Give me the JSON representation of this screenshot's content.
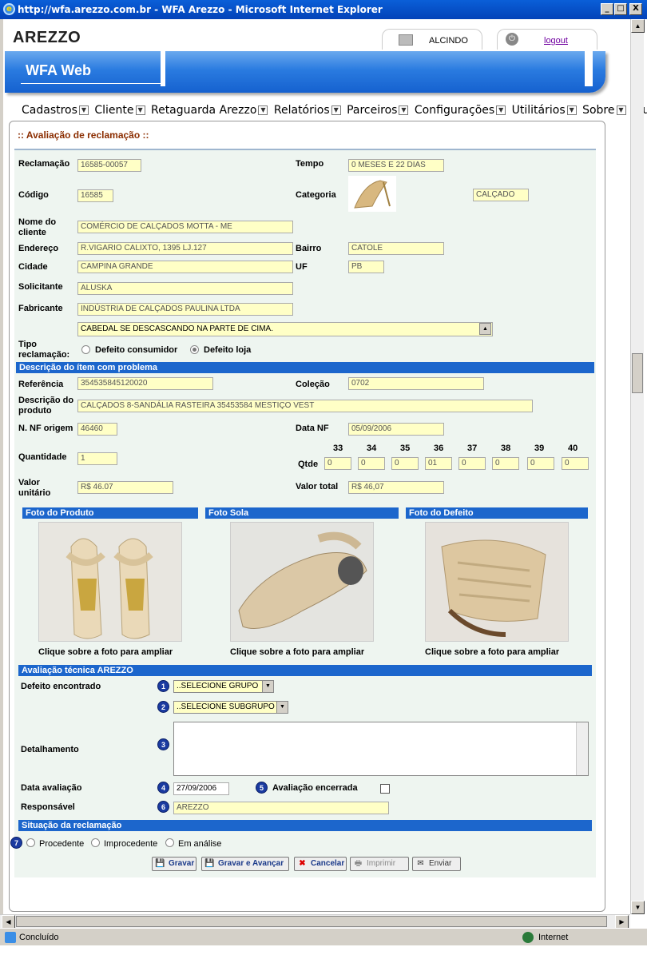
{
  "window": {
    "title": "http://wfa.arezzo.com.br - WFA Arezzo - Microsoft Internet Explorer",
    "min": "_",
    "max": "□",
    "close": "X"
  },
  "header": {
    "brand": "AREZZO",
    "user": "ALCINDO",
    "logout": "logout",
    "banner": "WFA Web"
  },
  "menu": [
    "Cadastros",
    "Cliente",
    "Retaguarda Arezzo",
    "Relatórios",
    "Parceiros",
    "Configurações",
    "Utilitários",
    "Sobre",
    "Ajuda"
  ],
  "panel": {
    "title": ":: Avaliação de reclamação ::"
  },
  "form": {
    "reclamacao_label": "Reclamação",
    "reclamacao": "16585-00057",
    "tempo_label": "Tempo",
    "tempo": "0 MESES E 22 DIAS",
    "codigo_label": "Código",
    "codigo": "16585",
    "categoria_label": "Categoria",
    "categoria": "CALÇADO",
    "nome_label": "Nome do cliente",
    "nome": "COMÉRCIO DE CALÇADOS MOTTA - ME",
    "endereco_label": "Endereço",
    "endereco": "R.VIGARIO CALIXTO, 1395 LJ.127",
    "bairro_label": "Bairro",
    "bairro": "CATOLE",
    "cidade_label": "Cidade",
    "cidade": "CAMPINA GRANDE",
    "uf_label": "UF",
    "uf": "PB",
    "solicitante_label": "Solicitante",
    "solicitante": "ALUSKA",
    "fabricante_label": "Fabricante",
    "fabricante": "INDÚSTRIA DE CALÇADOS PAULINA LTDA",
    "observacao": "CABEDAL SE DESCASCANDO NA PARTE DE CIMA.",
    "tipo_label": "Tipo reclamação:",
    "tipo_opt1": "Defeito consumidor",
    "tipo_opt2": "Defeito loja"
  },
  "item": {
    "section": "Descrição do ítem com problema",
    "referencia_label": "Referência",
    "referencia": "354535845120020",
    "colecao_label": "Coleção",
    "colecao": "0702",
    "descricao_label": "Descrição do produto",
    "descricao": "CALÇADOS 8-SANDÁLIA RASTEIRA 35453584 MESTIÇO VEST",
    "nf_label": "N. NF origem",
    "nf": "46460",
    "datanf_label": "Data NF",
    "datanf": "05/09/2006",
    "quantidade_label": "Quantidade",
    "quantidade": "1",
    "qtde_label": "Qtde",
    "sizes": [
      "33",
      "34",
      "35",
      "36",
      "37",
      "38",
      "39",
      "40"
    ],
    "qtys": [
      "0",
      "0",
      "0",
      "01",
      "0",
      "0",
      "0",
      "0"
    ],
    "valor_label": "Valor unitário",
    "valor": "R$ 46.07",
    "total_label": "Valor total",
    "total": "R$ 46,07"
  },
  "photos": {
    "produto": "Foto do Produto",
    "sola": "Foto Sola",
    "defeito": "Foto do Defeito",
    "caption": "Clique sobre a foto para ampliar"
  },
  "avaliacao": {
    "section": "Avaliação técnica AREZZO",
    "defeito_label": "Defeito encontrado",
    "grupo": "..SELECIONE GRUPO",
    "subgrupo": "..SELECIONE SUBGRUPO",
    "detalhamento_label": "Detalhamento",
    "data_label": "Data avaliação",
    "data": "27/09/2006",
    "encerrada_label": "Avaliação encerrada",
    "responsavel_label": "Responsável",
    "responsavel": "AREZZO",
    "steps": [
      "1",
      "2",
      "3",
      "4",
      "5",
      "6",
      "7"
    ]
  },
  "situacao": {
    "section": "Situação da reclamação",
    "opt1": "Procedente",
    "opt2": "Improcedente",
    "opt3": "Em análise"
  },
  "buttons": {
    "gravar": "Gravar",
    "gravar_avancar": "Gravar e Avançar",
    "cancelar": "Cancelar",
    "imprimir": "Imprimir",
    "enviar": "Enviar"
  },
  "status": {
    "left": "Concluído",
    "zone": "Internet"
  }
}
